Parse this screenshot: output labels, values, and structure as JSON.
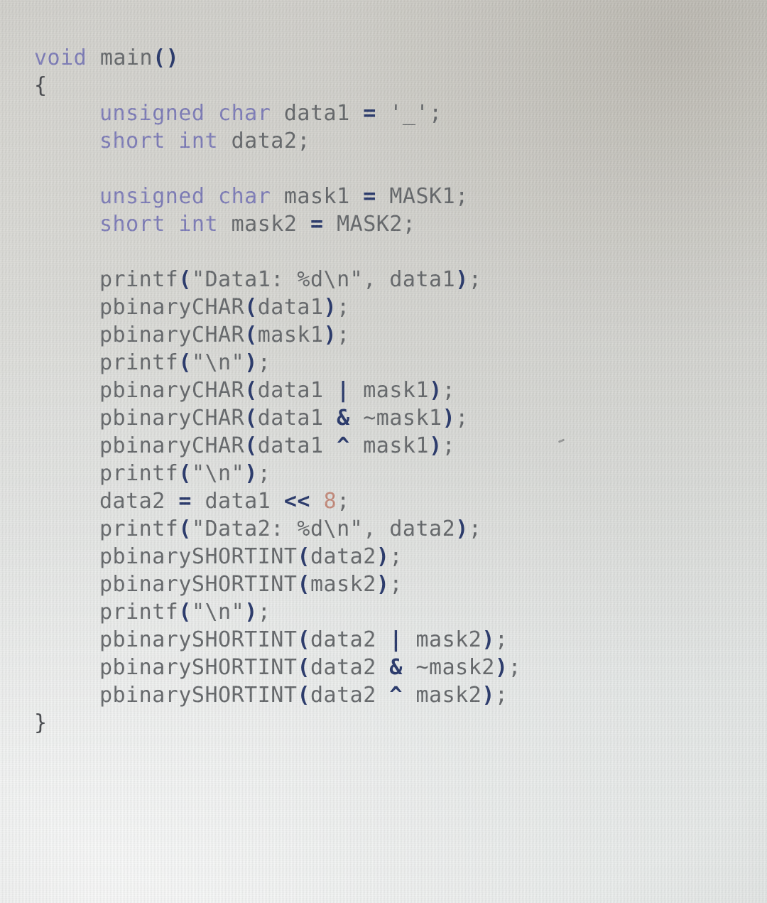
{
  "document": {
    "kind": "photographed-source-listing",
    "language": "C",
    "colors": {
      "paper": "#dfe1df",
      "text": "#6a6d70",
      "keyword": "#7d7cb8",
      "operator": "#2c3b6b",
      "number": "#c4897a",
      "brace": "#4a4c50"
    },
    "lines": [
      {
        "id": "l01",
        "indent": 0,
        "tokens": [
          {
            "t": "void",
            "c": "kw"
          },
          {
            "t": " "
          },
          {
            "t": "main",
            "c": "ident"
          },
          {
            "t": "()",
            "c": "punc"
          }
        ]
      },
      {
        "id": "l02",
        "indent": 0,
        "tokens": [
          {
            "t": "{",
            "c": "brace"
          }
        ]
      },
      {
        "id": "l03",
        "indent": 1,
        "tokens": [
          {
            "t": "unsigned char",
            "c": "kw"
          },
          {
            "t": " "
          },
          {
            "t": "data1",
            "c": "ident"
          },
          {
            "t": " "
          },
          {
            "t": "=",
            "c": "punc"
          },
          {
            "t": " "
          },
          {
            "t": "'_'",
            "c": "ident"
          },
          {
            "t": ";",
            "c": "ident"
          }
        ]
      },
      {
        "id": "l04",
        "indent": 1,
        "tokens": [
          {
            "t": "short int",
            "c": "kw"
          },
          {
            "t": " "
          },
          {
            "t": "data2;",
            "c": "ident"
          }
        ]
      },
      {
        "id": "l05",
        "indent": 1,
        "tokens": []
      },
      {
        "id": "l06",
        "indent": 1,
        "tokens": [
          {
            "t": "unsigned char",
            "c": "kw"
          },
          {
            "t": " "
          },
          {
            "t": "mask1",
            "c": "ident"
          },
          {
            "t": " "
          },
          {
            "t": "=",
            "c": "punc"
          },
          {
            "t": " "
          },
          {
            "t": "MASK1;",
            "c": "ident"
          }
        ]
      },
      {
        "id": "l07",
        "indent": 1,
        "tokens": [
          {
            "t": "short int",
            "c": "kw"
          },
          {
            "t": " "
          },
          {
            "t": "mask2",
            "c": "ident"
          },
          {
            "t": " "
          },
          {
            "t": "=",
            "c": "punc"
          },
          {
            "t": " "
          },
          {
            "t": "MASK2;",
            "c": "ident"
          }
        ]
      },
      {
        "id": "l08",
        "indent": 1,
        "tokens": []
      },
      {
        "id": "l09",
        "indent": 1,
        "tokens": [
          {
            "t": "printf",
            "c": "ident"
          },
          {
            "t": "(",
            "c": "punc"
          },
          {
            "t": "\"Data1: %d\\n\"",
            "c": "ident"
          },
          {
            "t": ", ",
            "c": "ident"
          },
          {
            "t": "data1",
            "c": "ident"
          },
          {
            "t": ")",
            "c": "punc"
          },
          {
            "t": ";",
            "c": "ident"
          }
        ]
      },
      {
        "id": "l10",
        "indent": 1,
        "tokens": [
          {
            "t": "pbinaryCHAR",
            "c": "ident"
          },
          {
            "t": "(",
            "c": "punc"
          },
          {
            "t": "data1",
            "c": "ident"
          },
          {
            "t": ")",
            "c": "punc"
          },
          {
            "t": ";",
            "c": "ident"
          }
        ]
      },
      {
        "id": "l11",
        "indent": 1,
        "tokens": [
          {
            "t": "pbinaryCHAR",
            "c": "ident"
          },
          {
            "t": "(",
            "c": "punc"
          },
          {
            "t": "mask1",
            "c": "ident"
          },
          {
            "t": ")",
            "c": "punc"
          },
          {
            "t": ";",
            "c": "ident"
          }
        ]
      },
      {
        "id": "l12",
        "indent": 1,
        "tokens": [
          {
            "t": "printf",
            "c": "ident"
          },
          {
            "t": "(",
            "c": "punc"
          },
          {
            "t": "\"\\n\"",
            "c": "ident"
          },
          {
            "t": ")",
            "c": "punc"
          },
          {
            "t": ";",
            "c": "ident"
          }
        ]
      },
      {
        "id": "l13",
        "indent": 1,
        "tokens": [
          {
            "t": "pbinaryCHAR",
            "c": "ident"
          },
          {
            "t": "(",
            "c": "punc"
          },
          {
            "t": "data1 ",
            "c": "ident"
          },
          {
            "t": "|",
            "c": "punc"
          },
          {
            "t": " mask1",
            "c": "ident"
          },
          {
            "t": ")",
            "c": "punc"
          },
          {
            "t": ";",
            "c": "ident"
          }
        ]
      },
      {
        "id": "l14",
        "indent": 1,
        "tokens": [
          {
            "t": "pbinaryCHAR",
            "c": "ident"
          },
          {
            "t": "(",
            "c": "punc"
          },
          {
            "t": "data1 ",
            "c": "ident"
          },
          {
            "t": "&",
            "c": "punc"
          },
          {
            "t": " ~mask1",
            "c": "ident"
          },
          {
            "t": ")",
            "c": "punc"
          },
          {
            "t": ";",
            "c": "ident"
          }
        ]
      },
      {
        "id": "l15",
        "indent": 1,
        "tokens": [
          {
            "t": "pbinaryCHAR",
            "c": "ident"
          },
          {
            "t": "(",
            "c": "punc"
          },
          {
            "t": "data1 ",
            "c": "ident"
          },
          {
            "t": "^",
            "c": "punc"
          },
          {
            "t": " mask1",
            "c": "ident"
          },
          {
            "t": ")",
            "c": "punc"
          },
          {
            "t": ";",
            "c": "ident"
          }
        ]
      },
      {
        "id": "l16",
        "indent": 1,
        "tokens": [
          {
            "t": "printf",
            "c": "ident"
          },
          {
            "t": "(",
            "c": "punc"
          },
          {
            "t": "\"\\n\"",
            "c": "ident"
          },
          {
            "t": ")",
            "c": "punc"
          },
          {
            "t": ";",
            "c": "ident"
          }
        ]
      },
      {
        "id": "l17",
        "indent": 1,
        "tokens": [
          {
            "t": "data2 ",
            "c": "ident"
          },
          {
            "t": "=",
            "c": "punc"
          },
          {
            "t": " data1 ",
            "c": "ident"
          },
          {
            "t": "<<",
            "c": "punc"
          },
          {
            "t": " ",
            "c": "ident"
          },
          {
            "t": "8",
            "c": "num"
          },
          {
            "t": ";",
            "c": "ident"
          }
        ]
      },
      {
        "id": "l18",
        "indent": 1,
        "tokens": [
          {
            "t": "printf",
            "c": "ident"
          },
          {
            "t": "(",
            "c": "punc"
          },
          {
            "t": "\"Data2: %d\\n\"",
            "c": "ident"
          },
          {
            "t": ", ",
            "c": "ident"
          },
          {
            "t": "data2",
            "c": "ident"
          },
          {
            "t": ")",
            "c": "punc"
          },
          {
            "t": ";",
            "c": "ident"
          }
        ]
      },
      {
        "id": "l19",
        "indent": 1,
        "tokens": [
          {
            "t": "pbinarySHORTINT",
            "c": "ident"
          },
          {
            "t": "(",
            "c": "punc"
          },
          {
            "t": "data2",
            "c": "ident"
          },
          {
            "t": ")",
            "c": "punc"
          },
          {
            "t": ";",
            "c": "ident"
          }
        ]
      },
      {
        "id": "l20",
        "indent": 1,
        "tokens": [
          {
            "t": "pbinarySHORTINT",
            "c": "ident"
          },
          {
            "t": "(",
            "c": "punc"
          },
          {
            "t": "mask2",
            "c": "ident"
          },
          {
            "t": ")",
            "c": "punc"
          },
          {
            "t": ";",
            "c": "ident"
          }
        ]
      },
      {
        "id": "l21",
        "indent": 1,
        "tokens": [
          {
            "t": "printf",
            "c": "ident"
          },
          {
            "t": "(",
            "c": "punc"
          },
          {
            "t": "\"\\n\"",
            "c": "ident"
          },
          {
            "t": ")",
            "c": "punc"
          },
          {
            "t": ";",
            "c": "ident"
          }
        ]
      },
      {
        "id": "l22",
        "indent": 1,
        "tokens": [
          {
            "t": "pbinarySHORTINT",
            "c": "ident"
          },
          {
            "t": "(",
            "c": "punc"
          },
          {
            "t": "data2 ",
            "c": "ident"
          },
          {
            "t": "|",
            "c": "punc"
          },
          {
            "t": " mask2",
            "c": "ident"
          },
          {
            "t": ")",
            "c": "punc"
          },
          {
            "t": ";",
            "c": "ident"
          }
        ]
      },
      {
        "id": "l23",
        "indent": 1,
        "tokens": [
          {
            "t": "pbinarySHORTINT",
            "c": "ident"
          },
          {
            "t": "(",
            "c": "punc"
          },
          {
            "t": "data2 ",
            "c": "ident"
          },
          {
            "t": "&",
            "c": "punc"
          },
          {
            "t": " ~mask2",
            "c": "ident"
          },
          {
            "t": ")",
            "c": "punc"
          },
          {
            "t": ";",
            "c": "ident"
          }
        ]
      },
      {
        "id": "l24",
        "indent": 1,
        "tokens": [
          {
            "t": "pbinarySHORTINT",
            "c": "ident"
          },
          {
            "t": "(",
            "c": "punc"
          },
          {
            "t": "data2 ",
            "c": "ident"
          },
          {
            "t": "^",
            "c": "punc"
          },
          {
            "t": " mask2",
            "c": "ident"
          },
          {
            "t": ")",
            "c": "punc"
          },
          {
            "t": ";",
            "c": "ident"
          }
        ]
      },
      {
        "id": "l25",
        "indent": 0,
        "tokens": [
          {
            "t": "}",
            "c": "brace"
          }
        ]
      }
    ]
  }
}
